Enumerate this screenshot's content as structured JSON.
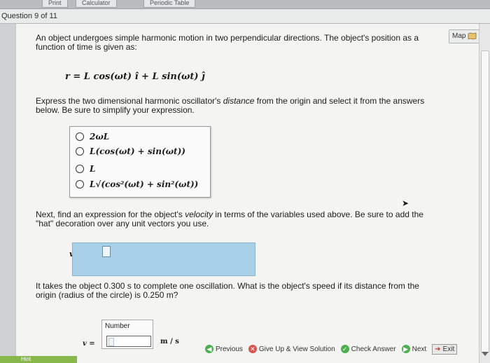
{
  "browser_tabs": [
    "Print",
    "Calculator",
    "Periodic Table"
  ],
  "question_header": "Question 9 of 11",
  "map_button": "Map",
  "prompt1_line1": "An object undergoes simple harmonic motion in two perpendicular directions. The object's position as a",
  "prompt1_line2": "function of time is given as:",
  "formula_text": "r = L cos(ωt) î + L sin(ωt) ĵ",
  "prompt2_line1a": "Express the two dimensional harmonic oscillator's ",
  "prompt2_line1b": "distance",
  "prompt2_line1c": " from the origin and select it from the answers",
  "prompt2_line2": "below. Be sure to simplify your expression.",
  "choices": [
    "2ωL",
    "L(cos(ωt) + sin(ωt))",
    "L",
    "L√(cos²(ωt) + sin²(ωt))"
  ],
  "prompt3_line1a": "Next, find an expression for the object's ",
  "prompt3_line1b": "velocity",
  "prompt3_line1c": " in terms of the variables used above. Be sure to add the",
  "prompt3_line2": "\"hat\" decoration over any unit vectors you use.",
  "velocity_label": "v =",
  "prompt4_line1": "It takes the object 0.300 s to complete one oscillation. What is the object's speed if its distance from the",
  "prompt4_line2": "origin (radius of the circle) is 0.250 m?",
  "number_label": "Number",
  "speed_label": "v =",
  "unit_label": "m / s",
  "nav": {
    "previous": "Previous",
    "give_up": "Give Up & View Solution",
    "check": "Check Answer",
    "next": "Next",
    "exit": "Exit"
  },
  "hint_label": "Hint",
  "colors": {
    "answer_box": "#a8d1e9",
    "nav_green": "#4caf50",
    "giveup_red": "#d9534f"
  }
}
